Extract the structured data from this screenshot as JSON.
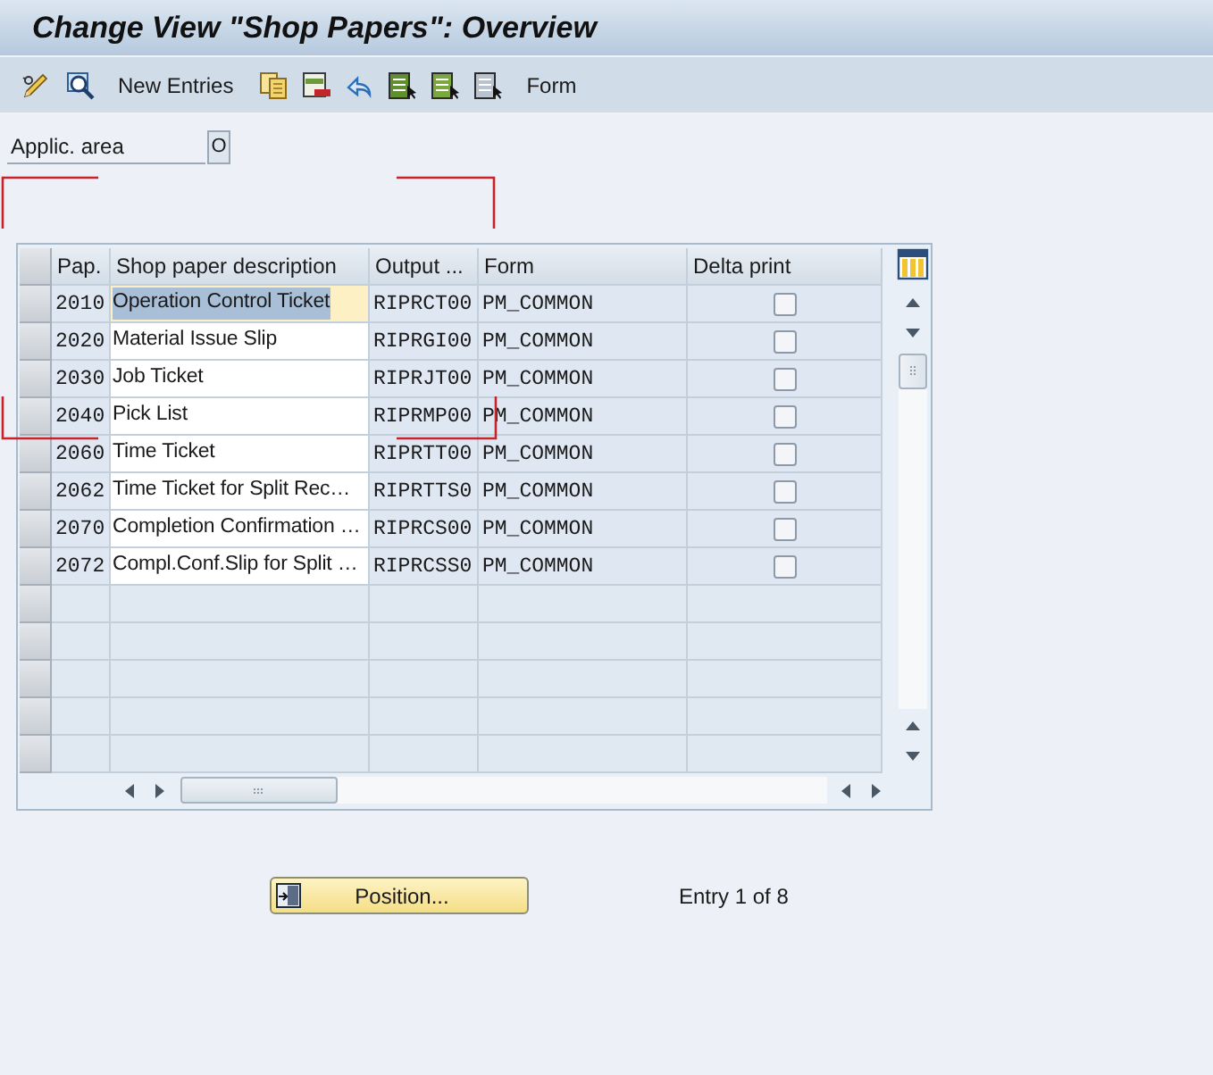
{
  "window": {
    "title": "Change View \"Shop Papers\": Overview"
  },
  "toolbar": {
    "buttons": [
      "New Entries",
      "Form"
    ]
  },
  "filter": {
    "label": "Applic. area",
    "value": "O"
  },
  "table": {
    "columns": [
      "Pap.",
      "Shop paper description",
      "Output ...",
      "Form",
      "Delta print"
    ],
    "rows": [
      {
        "cells": [
          "2010",
          "Operation Control Ticket",
          "RIPRCT00",
          "PM_COMMON"
        ],
        "delta_print": false,
        "focused": true
      },
      {
        "cells": [
          "2020",
          "Material Issue Slip",
          "RIPRGI00",
          "PM_COMMON"
        ],
        "delta_print": false,
        "focused": false
      },
      {
        "cells": [
          "2030",
          "Job Ticket",
          "RIPRJT00",
          "PM_COMMON"
        ],
        "delta_print": false,
        "focused": false
      },
      {
        "cells": [
          "2040",
          "Pick List",
          "RIPRMP00",
          "PM_COMMON"
        ],
        "delta_print": false,
        "focused": false
      },
      {
        "cells": [
          "2060",
          "Time Ticket",
          "RIPRTT00",
          "PM_COMMON"
        ],
        "delta_print": false,
        "focused": false
      },
      {
        "cells": [
          "2062",
          "Time Ticket for Split Rec…",
          "RIPRTTS0",
          "PM_COMMON"
        ],
        "delta_print": false,
        "focused": false
      },
      {
        "cells": [
          "2070",
          "Completion Confirmation …",
          "RIPRCS00",
          "PM_COMMON"
        ],
        "delta_print": false,
        "focused": false
      },
      {
        "cells": [
          "2072",
          "Compl.Conf.Slip for Split …",
          "RIPRCSS0",
          "PM_COMMON"
        ],
        "delta_print": false,
        "focused": false
      }
    ]
  },
  "footer": {
    "position_button": "Position...",
    "entry_info": "Entry 1 of 8"
  }
}
